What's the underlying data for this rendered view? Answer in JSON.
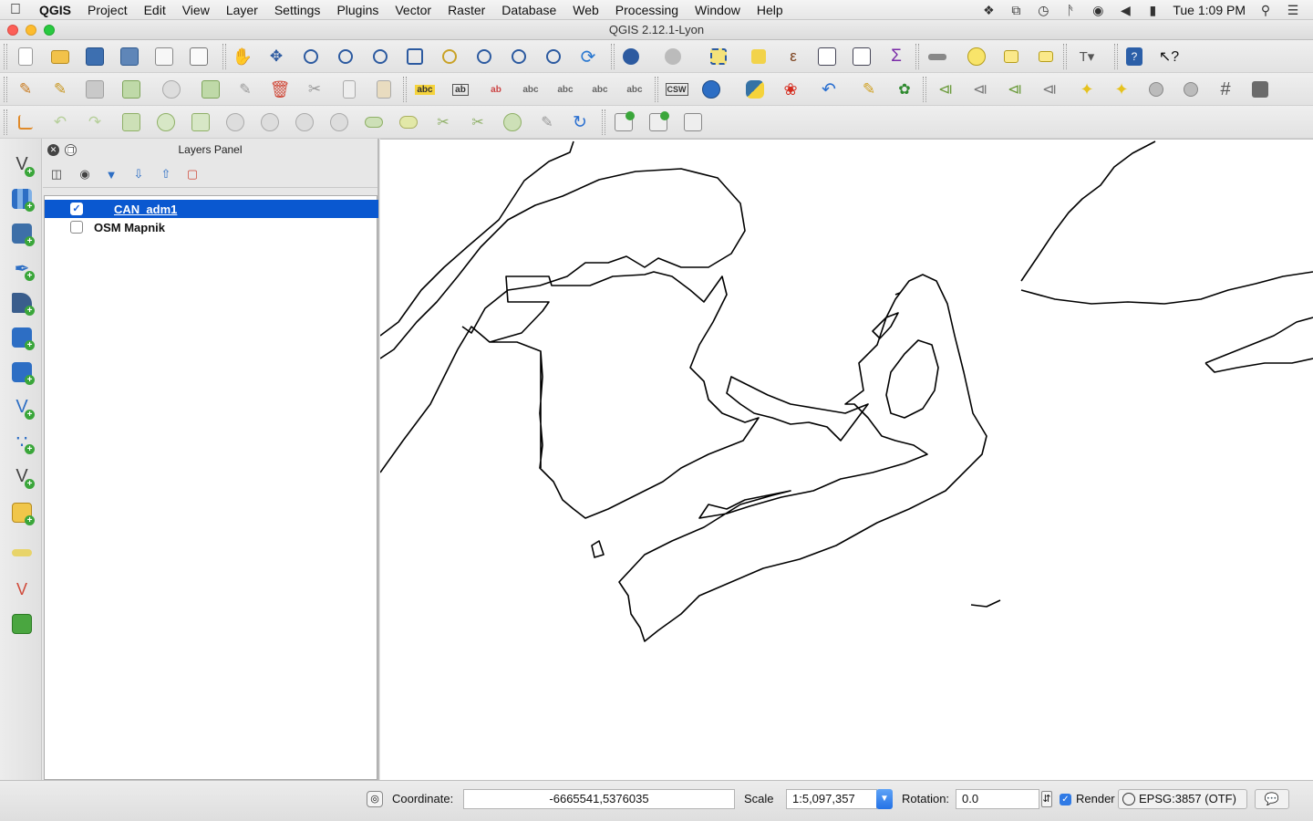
{
  "menubar": {
    "app_name": "QGIS",
    "items": [
      "Project",
      "Edit",
      "View",
      "Layer",
      "Settings",
      "Plugins",
      "Vector",
      "Raster",
      "Database",
      "Web",
      "Processing",
      "Window",
      "Help"
    ],
    "clock": "Tue 1:09 PM",
    "tray_icons": [
      "dropbox-icon",
      "screen-share-icon",
      "time-machine-icon",
      "bluetooth-icon",
      "wifi-icon",
      "volume-icon",
      "battery-icon",
      "spotlight-icon",
      "notification-center-icon"
    ]
  },
  "window": {
    "title": "QGIS 2.12.1-Lyon"
  },
  "toolbar_row1": [
    "new-project-icon",
    "open-project-icon",
    "save-project-icon",
    "save-as-icon",
    "new-print-composer-icon",
    "composer-manager-icon",
    "pan-icon",
    "pan-to-selection-icon",
    "zoom-in-icon",
    "zoom-out-icon",
    "zoom-actual-size-icon",
    "zoom-full-icon",
    "zoom-to-selection-icon",
    "zoom-to-layer-icon",
    "zoom-last-icon",
    "zoom-next-icon",
    "refresh-icon",
    "identify-icon",
    "action-icon",
    "select-features-icon",
    "deselect-icon",
    "select-by-expression-icon",
    "attribute-table-icon",
    "field-calculator-icon",
    "statistics-icon",
    "measure-icon",
    "map-tips-icon",
    "new-bookmark-icon",
    "show-bookmarks-icon",
    "text-annotation-icon",
    "help-icon",
    "whats-this-icon"
  ],
  "toolbar_row2": [
    "current-edits-icon",
    "toggle-editing-icon",
    "save-edits-icon",
    "add-feature-icon",
    "add-part-icon",
    "move-feature-icon",
    "node-tool-icon",
    "delete-selected-icon",
    "cut-features-icon",
    "copy-features-icon",
    "paste-features-icon",
    "label-icon",
    "pin-labels-icon",
    "highlight-labels-icon",
    "show-hide-labels-icon",
    "move-label-icon",
    "rotate-label-icon",
    "change-label-icon",
    "csw-icon",
    "metasearch-icon",
    "python-console-icon",
    "canada-maple-icon",
    "undo-icon",
    "digitize-icon",
    "plugin-bug-icon",
    "shortest-path-icon",
    "tree-1-icon",
    "tree-2-icon",
    "tree-3-icon",
    "add-light-icon",
    "add-light-2-icon",
    "sphere-icon",
    "sphere-2-icon",
    "grid-icon",
    "raster-calc-icon"
  ],
  "toolbar_row2_text": {
    "abc": "abc",
    "ab": "ab",
    "csw": "CSW"
  },
  "toolbar_row3": [
    "advanced-digitizing-icon",
    "undo-icon",
    "redo-icon",
    "simplify-icon",
    "add-ring-icon",
    "add-part-icon",
    "fill-ring-icon",
    "delete-ring-icon",
    "delete-part-icon",
    "reshape-icon",
    "offset-curve-icon",
    "split-features-icon",
    "split-parts-icon",
    "merge-selected-icon",
    "merge-attributes-icon",
    "rotate-point-symbols-icon",
    "rotate-icon",
    "georeferencer-icon",
    "add-gps-icon",
    "spatial-bookmark-icon"
  ],
  "left_toolbar": [
    "add-vector-layer-icon",
    "add-raster-layer-icon",
    "add-postgis-layer-icon",
    "add-spatialite-layer-icon",
    "add-mssql-layer-icon",
    "add-wms-layer-icon",
    "add-wcs-layer-icon",
    "add-wfs-layer-icon",
    "add-delimited-text-icon",
    "new-shapefile-icon",
    "add-virtual-layer-icon",
    "add-oracle-layer-icon",
    "add-db2-layer-icon",
    "add-gpx-icon"
  ],
  "layers_panel": {
    "title": "Layers Panel",
    "tool_icons": [
      "add-group-icon",
      "manage-visibility-icon",
      "filter-icon",
      "expand-all-icon",
      "collapse-all-icon",
      "remove-layer-icon"
    ],
    "layers": [
      {
        "name": "CAN_adm1",
        "checked": true,
        "selected": true
      },
      {
        "name": "OSM Mapnik",
        "checked": false,
        "selected": false
      }
    ]
  },
  "statusbar": {
    "coordinate_label": "Coordinate:",
    "coordinate_value": "-6665541,5376035",
    "scale_label": "Scale",
    "scale_value": "1:5,097,357",
    "rotation_label": "Rotation:",
    "rotation_value": "0.0",
    "render_label": "Render",
    "render_checked": true,
    "crs": "EPSG:3857 (OTF)"
  },
  "colors": {
    "selection": "#0a58d0",
    "map_line": "#000000"
  }
}
